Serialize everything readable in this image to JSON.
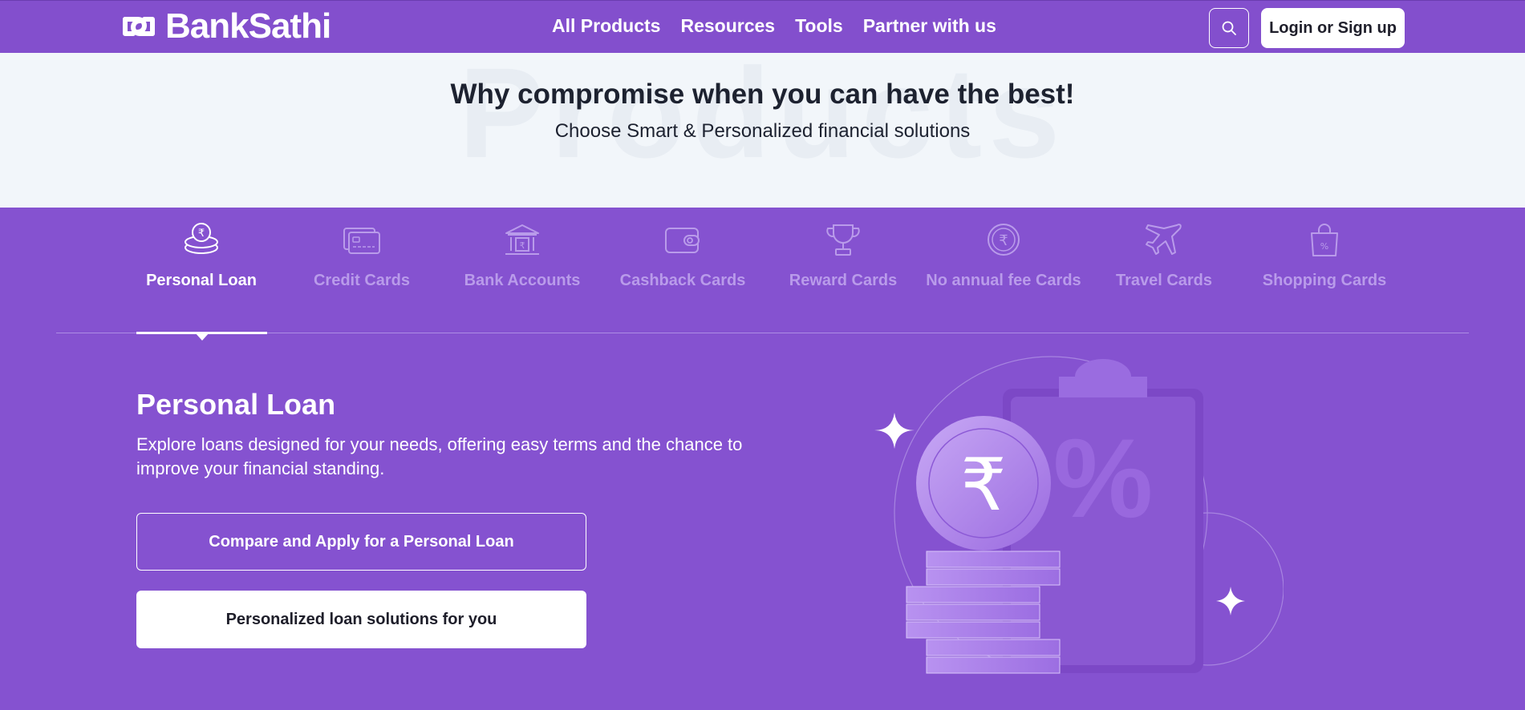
{
  "nav": {
    "brand": "BankSathi",
    "links": [
      "All Products",
      "Resources",
      "Tools",
      "Partner with us"
    ],
    "search_icon": "search-icon",
    "login_label": "Login or Sign up"
  },
  "hero": {
    "watermark": "Products",
    "title": "Why compromise when you can have the best!",
    "subtitle": "Choose Smart & Personalized financial solutions"
  },
  "tabs": [
    {
      "label": "Personal Loan",
      "icon": "coin-stack-icon",
      "active": true
    },
    {
      "label": "Credit Cards",
      "icon": "credit-card-icon",
      "active": false
    },
    {
      "label": "Bank Accounts",
      "icon": "bank-icon",
      "active": false
    },
    {
      "label": "Cashback Cards",
      "icon": "wallet-icon",
      "active": false
    },
    {
      "label": "Reward Cards",
      "icon": "trophy-icon",
      "active": false
    },
    {
      "label": "No annual fee Cards",
      "icon": "rupee-coin-icon",
      "active": false
    },
    {
      "label": "Travel Cards",
      "icon": "airplane-icon",
      "active": false
    },
    {
      "label": "Shopping Cards",
      "icon": "shopping-bag-icon",
      "active": false
    }
  ],
  "content": {
    "title": "Personal Loan",
    "description": "Explore loans designed for your needs, offering easy terms and the chance to improve your financial standing.",
    "primary_button": "Compare and Apply for a Personal Loan",
    "secondary_button": "Personalized loan solutions for you"
  },
  "illustration": {
    "currency_symbol": "₹",
    "percent_symbol": "%"
  },
  "colors": {
    "brand_purple": "#834fcd",
    "hero_background": "#f2f6fa",
    "inactive_tab": "#b99bea"
  }
}
